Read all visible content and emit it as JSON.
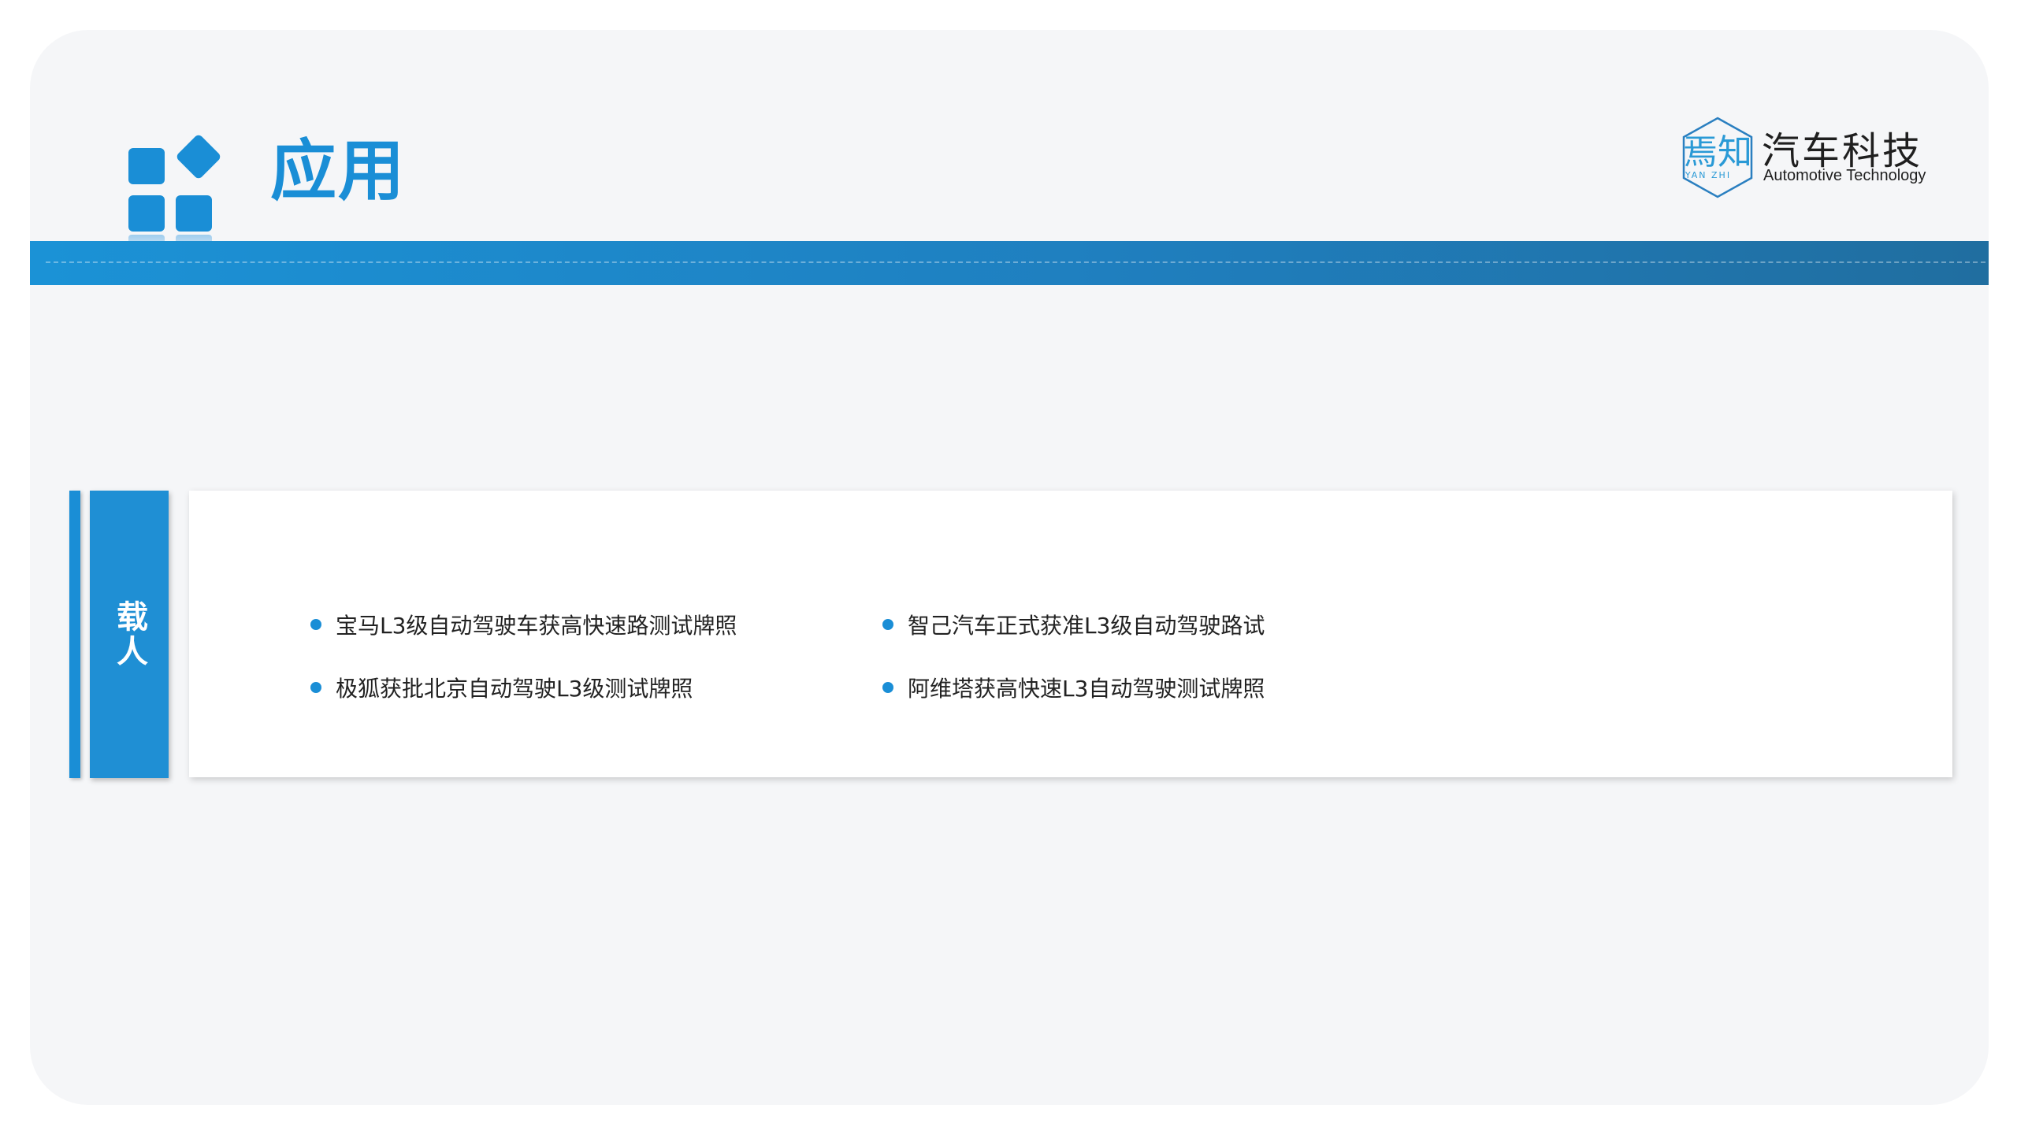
{
  "header": {
    "title": "应用",
    "brand": {
      "logo_mark": "焉知",
      "logo_sub": "YAN ZHI",
      "name_cn": "汽车科技",
      "name_en": "Automotive Technology"
    }
  },
  "section": {
    "label": "载人",
    "items": [
      "宝马L3级自动驾驶车获高快速路测试牌照",
      "智己汽车正式获准L3级自动驾驶路试",
      "极狐获批北京自动驾驶L3级测试牌照",
      "阿维塔获高快速L3自动驾驶测试牌照"
    ]
  },
  "colors": {
    "accent": "#1a8ed6",
    "band_start": "#1b92d6",
    "band_end": "#206ea0",
    "background": "#f5f6f8"
  }
}
